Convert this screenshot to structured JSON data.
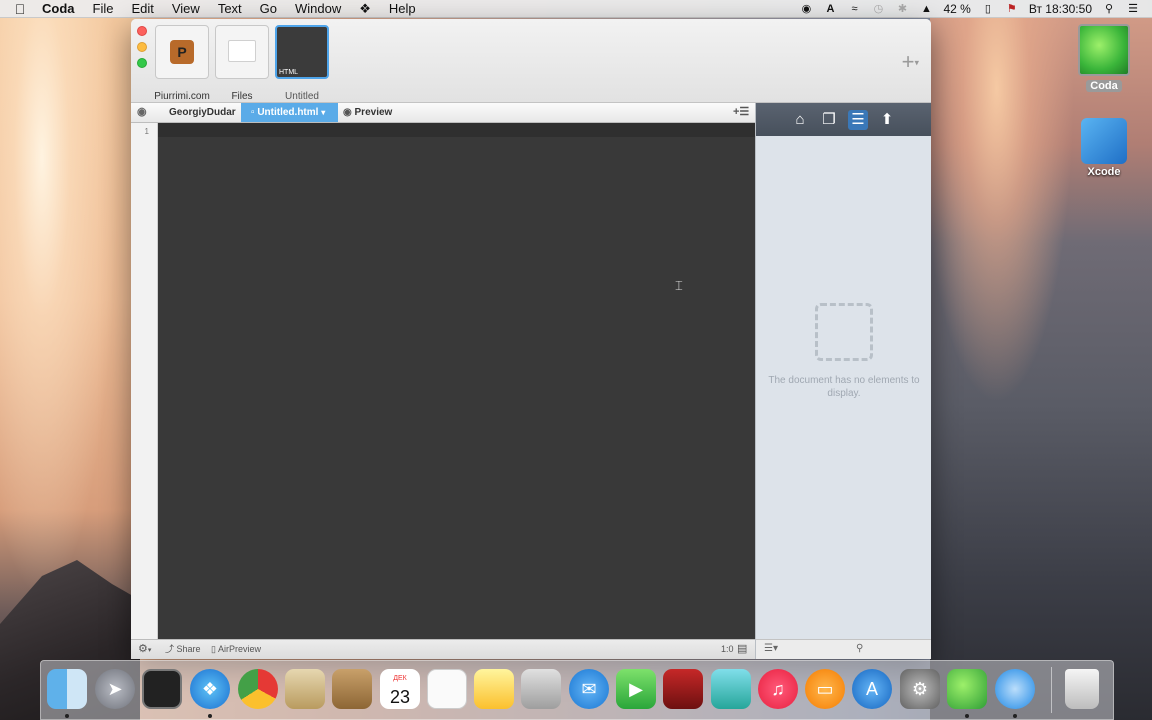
{
  "menubar": {
    "apple": "",
    "app": "Coda",
    "items": [
      "File",
      "Edit",
      "View",
      "Text",
      "Go",
      "Window",
      "Help"
    ],
    "battery": "42 %",
    "clock": "Вт 18:30:50"
  },
  "desktop": {
    "coda_label": "Coda",
    "xcode_label": "Xcode"
  },
  "window": {
    "sites": [
      {
        "name": "Piurrimi.com"
      },
      {
        "name": "Files"
      },
      {
        "name": "Untitled",
        "badge": "HTML"
      }
    ],
    "breadcrumbs": {
      "user": "GeorgiyDudar",
      "file": "Untitled.html",
      "preview": "Preview"
    },
    "editor": {
      "line_numbers": [
        "1"
      ]
    },
    "panel": {
      "empty_message": "The document has no elements to display."
    },
    "statusbar": {
      "share": "Share",
      "airpreview": "AirPreview",
      "position": "1:0"
    }
  },
  "dock": {
    "calendar_month": "ДЕК",
    "calendar_day": "23"
  },
  "colors": {
    "accent": "#5aabe8",
    "editor_bg": "#393939",
    "panel_bg": "#dde3ea"
  }
}
